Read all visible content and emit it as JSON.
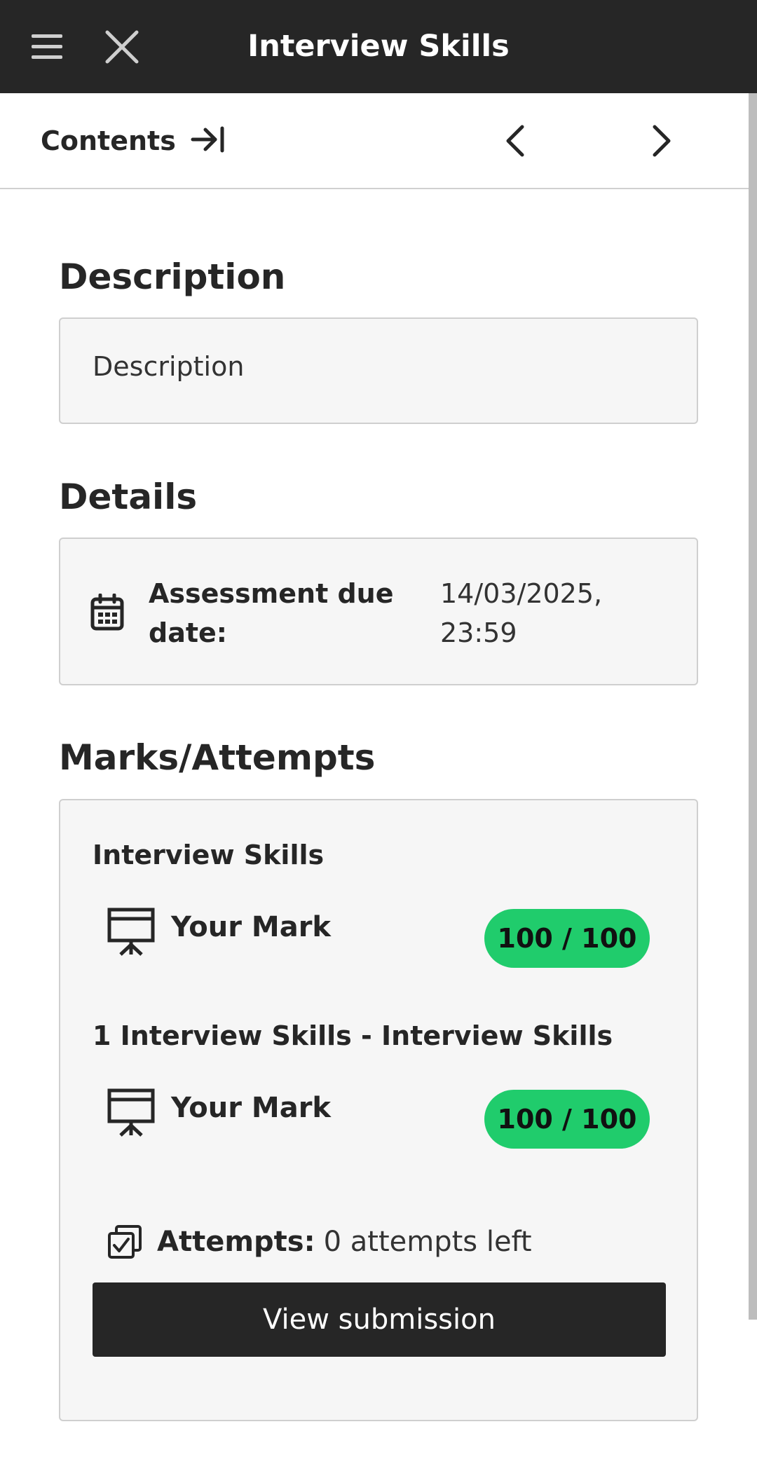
{
  "header": {
    "title": "Interview Skills",
    "menu_icon": "hamburger-icon",
    "close_icon": "close-icon"
  },
  "nav": {
    "contents_label": "Contents",
    "contents_icon": "arrow-to-right-bar-icon",
    "prev_icon": "chevron-left-icon",
    "next_icon": "chevron-right-icon"
  },
  "description": {
    "heading": "Description",
    "text": "Description"
  },
  "details": {
    "heading": "Details",
    "icon": "calendar-icon",
    "label": "Assessment due date:",
    "value": "14/03/2025, 23:59"
  },
  "marks": {
    "heading": "Marks/Attempts",
    "items": [
      {
        "title": "Interview Skills",
        "icon": "presentation-board-icon",
        "label": "Your Mark",
        "score": "100 / 100"
      },
      {
        "title": "1 Interview Skills - Interview Skills",
        "icon": "presentation-board-icon",
        "label": "Your Mark",
        "score": "100 / 100"
      }
    ],
    "attempts_icon": "checkbox-stack-icon",
    "attempts_label": "Attempts:",
    "attempts_value": "0 attempts left",
    "view_button": "View submission"
  },
  "colors": {
    "topbar": "#262626",
    "score_pill": "#20cc6c",
    "box_bg": "#f6f6f6"
  }
}
